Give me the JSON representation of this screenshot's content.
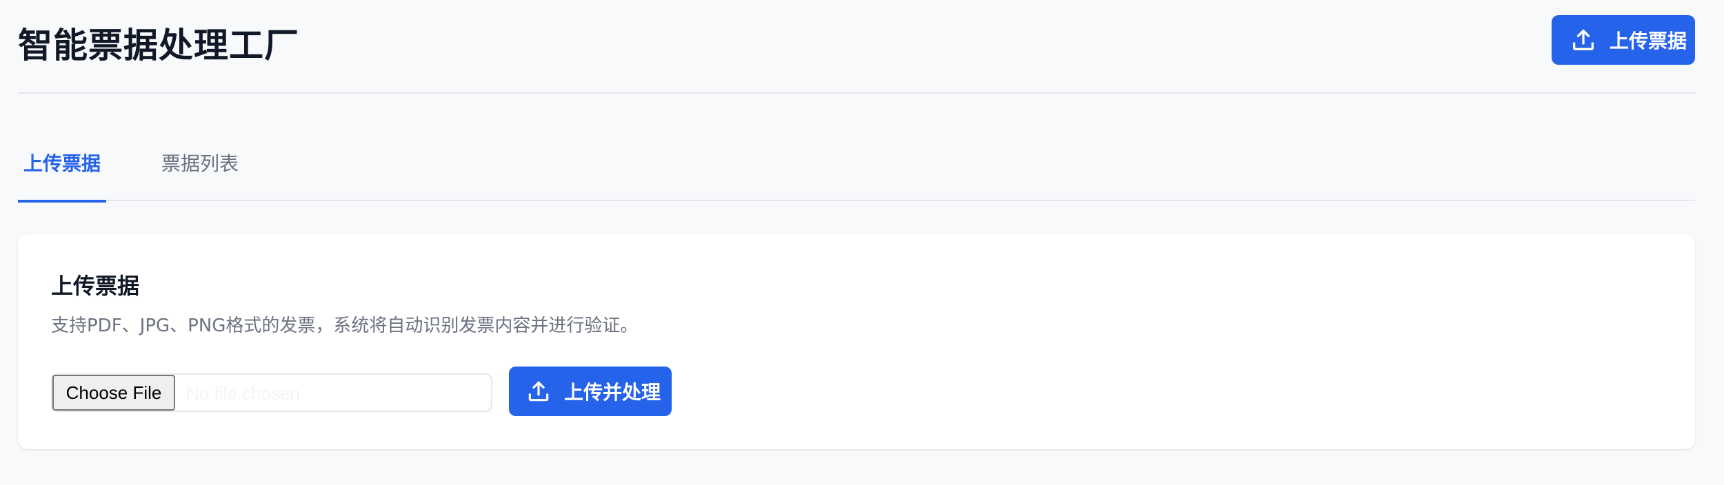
{
  "header": {
    "title": "智能票据处理工厂",
    "upload_button_label": "上传票据",
    "upload_icon": "upload-icon"
  },
  "tabs": [
    {
      "label": "上传票据",
      "active": true
    },
    {
      "label": "票据列表",
      "active": false
    }
  ],
  "card": {
    "title": "上传票据",
    "description": "支持PDF、JPG、PNG格式的发票，系统将自动识别发票内容并进行验证。",
    "file_input": {
      "button_label": "Choose File",
      "status_text": "No file chosen"
    },
    "process_button_label": "上传并处理",
    "process_icon": "upload-icon"
  },
  "colors": {
    "accent": "#2563eb",
    "background": "#f8f9fb",
    "card": "#ffffff",
    "muted_text": "#6b7280"
  }
}
